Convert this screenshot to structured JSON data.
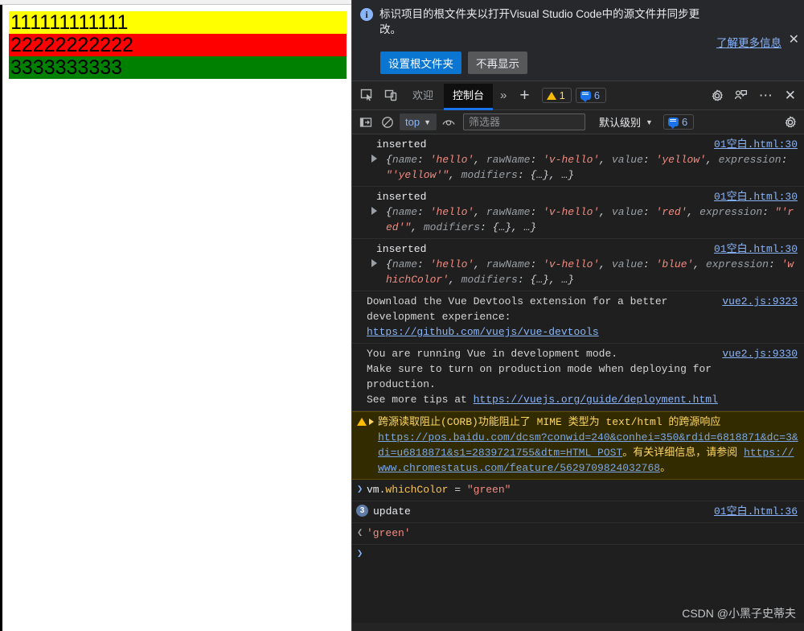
{
  "page": {
    "bars": [
      {
        "text": "111111111111",
        "bg": "#ffff00",
        "color": "#000000"
      },
      {
        "text": "22222222222",
        "bg": "#ff0000",
        "color": "#000000"
      },
      {
        "text": "3333333333",
        "bg": "#008000",
        "color": "#000000"
      }
    ]
  },
  "infobar": {
    "icon": "info-icon",
    "message": "标识项目的根文件夹以打开Visual Studio Code中的源文件并同步更改。",
    "learn_more": "了解更多信息",
    "close": "✕",
    "primary_button": "设置根文件夹",
    "secondary_button": "不再显示"
  },
  "tabbar": {
    "inspect_icon": "inspect-element-icon",
    "device_icon": "device-toolbar-icon",
    "tabs": [
      {
        "label": "欢迎",
        "active": false
      },
      {
        "label": "控制台",
        "active": true
      }
    ],
    "more_tabs": "»",
    "add_tab": "+",
    "warning_count": "1",
    "info_count": "6",
    "settings_icon": "gear-icon",
    "feedback_icon": "feedback-icon",
    "more_icon": "⋯",
    "close_icon": "✕"
  },
  "filterbar": {
    "sidebar_icon": "console-sidebar-icon",
    "clear_icon": "clear-console-icon",
    "context": "top",
    "context_caret": "▼",
    "eye_icon": "live-expression-icon",
    "filter_placeholder": "筛选器",
    "filter_value": "",
    "level": "默认级别",
    "level_caret": "▼",
    "info_count": "6",
    "settings_icon": "gear-icon"
  },
  "console": {
    "messages": [
      {
        "type": "log",
        "label": "inserted",
        "source": "01空白.html:30",
        "object_parts": [
          {
            "t": "plain",
            "v": "{"
          },
          {
            "t": "key",
            "v": "name"
          },
          {
            "t": "plain",
            "v": ": "
          },
          {
            "t": "str",
            "v": "'hello'"
          },
          {
            "t": "plain",
            "v": ", "
          },
          {
            "t": "key",
            "v": "rawName"
          },
          {
            "t": "plain",
            "v": ": "
          },
          {
            "t": "str",
            "v": "'v-hello'"
          },
          {
            "t": "plain",
            "v": ", "
          },
          {
            "t": "key",
            "v": "value"
          },
          {
            "t": "plain",
            "v": ": "
          },
          {
            "t": "str",
            "v": "'yellow'"
          },
          {
            "t": "plain",
            "v": ", "
          },
          {
            "t": "key",
            "v": "expression"
          },
          {
            "t": "plain",
            "v": ": "
          },
          {
            "t": "str",
            "v": "\"'yellow'\""
          },
          {
            "t": "plain",
            "v": ", "
          },
          {
            "t": "key",
            "v": "modifiers"
          },
          {
            "t": "plain",
            "v": ": {…}, …}"
          }
        ]
      },
      {
        "type": "log",
        "label": "inserted",
        "source": "01空白.html:30",
        "object_parts": [
          {
            "t": "plain",
            "v": "{"
          },
          {
            "t": "key",
            "v": "name"
          },
          {
            "t": "plain",
            "v": ": "
          },
          {
            "t": "str",
            "v": "'hello'"
          },
          {
            "t": "plain",
            "v": ", "
          },
          {
            "t": "key",
            "v": "rawName"
          },
          {
            "t": "plain",
            "v": ": "
          },
          {
            "t": "str",
            "v": "'v-hello'"
          },
          {
            "t": "plain",
            "v": ", "
          },
          {
            "t": "key",
            "v": "value"
          },
          {
            "t": "plain",
            "v": ": "
          },
          {
            "t": "str",
            "v": "'red'"
          },
          {
            "t": "plain",
            "v": ", "
          },
          {
            "t": "key",
            "v": "expression"
          },
          {
            "t": "plain",
            "v": ": "
          },
          {
            "t": "str",
            "v": "\"'red'\""
          },
          {
            "t": "plain",
            "v": ", "
          },
          {
            "t": "key",
            "v": "modifiers"
          },
          {
            "t": "plain",
            "v": ": {…}, …}"
          }
        ]
      },
      {
        "type": "log",
        "label": "inserted",
        "source": "01空白.html:30",
        "object_parts": [
          {
            "t": "plain",
            "v": "{"
          },
          {
            "t": "key",
            "v": "name"
          },
          {
            "t": "plain",
            "v": ": "
          },
          {
            "t": "str",
            "v": "'hello'"
          },
          {
            "t": "plain",
            "v": ", "
          },
          {
            "t": "key",
            "v": "rawName"
          },
          {
            "t": "plain",
            "v": ": "
          },
          {
            "t": "str",
            "v": "'v-hello'"
          },
          {
            "t": "plain",
            "v": ", "
          },
          {
            "t": "key",
            "v": "value"
          },
          {
            "t": "plain",
            "v": ": "
          },
          {
            "t": "str",
            "v": "'blue'"
          },
          {
            "t": "plain",
            "v": ", "
          },
          {
            "t": "key",
            "v": "expression"
          },
          {
            "t": "plain",
            "v": ": "
          },
          {
            "t": "str",
            "v": "'whichColor'"
          },
          {
            "t": "plain",
            "v": ", "
          },
          {
            "t": "key",
            "v": "modifiers"
          },
          {
            "t": "plain",
            "v": ": {…}, …}"
          }
        ]
      }
    ],
    "devtools_tip": {
      "line1": "Download the Vue Devtools extension for a better",
      "line2": "development experience:",
      "link": "https://github.com/vuejs/vue-devtools",
      "source": "vue2.js:9323"
    },
    "dev_mode": {
      "line1": "You are running Vue in development mode.",
      "line2": "Make sure to turn on production mode when deploying for",
      "line3": "production.",
      "line4_prefix": "See more tips at ",
      "line4_link": "https://vuejs.org/guide/deployment.html",
      "source": "vue2.js:9330"
    },
    "corb_warning": {
      "text_before": "跨源读取阻止(CORB)功能阻止了 MIME 类型为 text/html 的跨源响应 ",
      "link1": "https://pos.baidu.com/dcsm?conwid=240&conhei=350&rdid=6818871&dc=3&di=u6818871&s1=2839721755&dtm=HTML_POST",
      "text_middle": "。有关详细信息，请参阅 ",
      "link2": "https://www.chromestatus.com/feature/5629709824032768",
      "text_after": "。"
    },
    "input_echo": {
      "chevron": "❯",
      "obj": "vm",
      "dot": ".",
      "prop": "whichColor",
      "op": " = ",
      "value": "\"green\""
    },
    "update_log": {
      "count": "3",
      "label": "update",
      "source": "01空白.html:36"
    },
    "result": {
      "chevron": "❮",
      "value": "'green'"
    },
    "prompt": "❯"
  },
  "watermark": "CSDN @小黑子史蒂夫"
}
